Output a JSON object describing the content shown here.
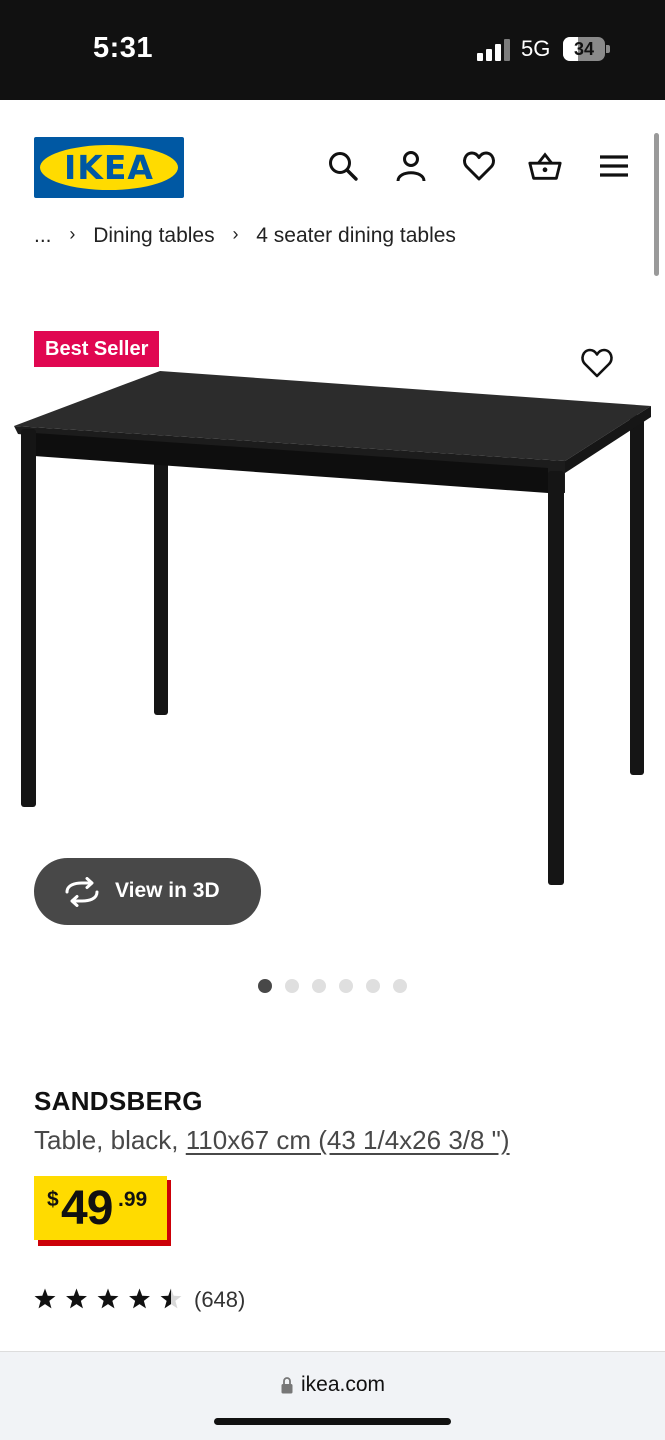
{
  "status_bar": {
    "time": "5:31",
    "network": "5G",
    "battery": "34"
  },
  "header": {
    "logo_text": "IKEA",
    "icons": [
      "search-icon",
      "account-icon",
      "favourites-icon",
      "cart-icon",
      "menu-icon"
    ]
  },
  "breadcrumb": {
    "items": [
      "...",
      "Dining tables",
      "4 seater dining tables"
    ],
    "separator": "›"
  },
  "product": {
    "badge": "Best Seller",
    "view_3d_label": "View in 3D",
    "gallery_count": 6,
    "gallery_active_index": 0,
    "name": "SANDSBERG",
    "desc_prefix": "Table, black, ",
    "desc_dims": "110x67 cm (43 1/4x26 3/8 \")",
    "price_currency": "$",
    "price_integer": "49",
    "price_decimal": ".99",
    "rating_value": 4.5,
    "rating_max": 5,
    "rating_count": "(648)"
  },
  "browser": {
    "url": "ikea.com"
  },
  "colors": {
    "ikea_blue": "#0058a3",
    "ikea_yellow": "#ffdb00",
    "badge_red": "#e00751",
    "price_shadow_red": "#cc0008",
    "button_grey": "#484848"
  }
}
